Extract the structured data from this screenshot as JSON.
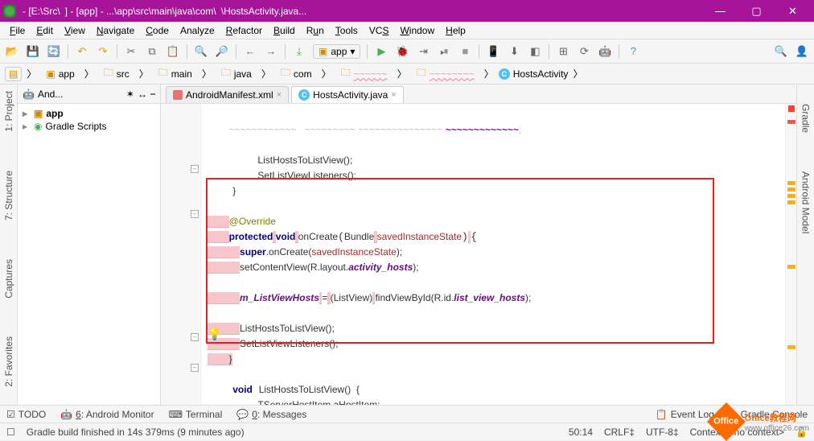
{
  "title": {
    "seg1": "- [E:\\Src\\",
    "seg2": "] - [app] - ...\\app\\src\\main\\java\\com\\",
    "seg3": "\\HostsActivity.java..."
  },
  "menu": {
    "file": "File",
    "edit": "Edit",
    "view": "View",
    "navigate": "Navigate",
    "code": "Code",
    "analyze": "Analyze",
    "refactor": "Refactor",
    "build": "Build",
    "run": "Run",
    "tools": "Tools",
    "vcs": "VCS",
    "window": "Window",
    "help": "Help"
  },
  "runConfig": "app",
  "breadcrumbs": {
    "app": "app",
    "src": "src",
    "main": "main",
    "java": "java",
    "com": "com",
    "cls": "HostsActivity"
  },
  "projectPanel": {
    "title": "And...",
    "app": "app",
    "gradle": "Gradle Scripts"
  },
  "tabs": {
    "manifest": "AndroidManifest.xml",
    "hosts": "HostsActivity.java"
  },
  "rails": {
    "project": "1: Project",
    "structure": "7: Structure",
    "captures": "Captures",
    "favorites": "2: Favorites",
    "gradle": "Gradle",
    "android": "Android Model"
  },
  "code": {
    "l1a": "ListHostsToListView();",
    "l1b": "SetListViewListeners();",
    "brace_close": "}",
    "override": "@Override",
    "protected": "protected",
    "void": "void",
    "onCreate": "onCreate",
    "bundle": "Bundle",
    "sis": "savedInstanceState",
    "superline_a": "super",
    "superline_b": ".onCreate(",
    "superline_c": "savedInstanceState",
    "superline_d": ");",
    "scv_a": "setContentView(R.layout.",
    "scv_b": "activity_hosts",
    "scv_c": ");",
    "mlv": "m_ListViewHosts",
    "eq": "=",
    "cast": "(ListView)",
    "fvbi": "findViewById(R.id.",
    "lvh": "list_view_hosts",
    "end": ");",
    "l2a": "ListHostsToListView();",
    "l2b": "SetListViewListeners();",
    "close2": "}",
    "fn2_a": "void",
    "fn2_b": "ListHostsToListView()  {",
    "fn2_c": "TServerHostItem aHostItem;"
  },
  "bottom": {
    "todo": "TODO",
    "monitor": "6: Android Monitor",
    "terminal": "Terminal",
    "messages": "0: Messages",
    "eventlog": "Event Log",
    "gradlec": "Gradle Console"
  },
  "status": {
    "msg": "Gradle build finished in 14s 379ms (9 minutes ago)",
    "pos": "50:14",
    "le": "CRLF‡",
    "enc": "UTF-8‡",
    "ctx": "Context: <no context>"
  },
  "watermark": {
    "t1": "Office教程网",
    "t2": "www.office26.com"
  }
}
